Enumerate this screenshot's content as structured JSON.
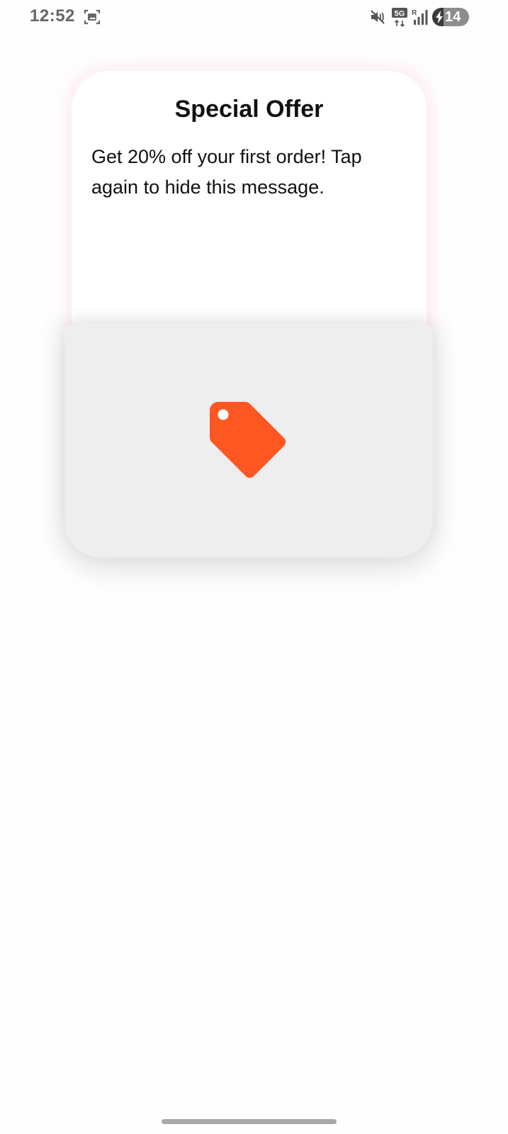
{
  "status_bar": {
    "time": "12:52",
    "network_label": "5G",
    "roaming_label": "R",
    "battery_level": "14",
    "icons": [
      "screenshot-icon",
      "mute-icon",
      "5g-network-icon",
      "signal-icon",
      "battery-charging-icon"
    ]
  },
  "offer": {
    "title": "Special Offer",
    "message": "Get 20% off your first order! Tap again to hide this message."
  },
  "cover": {
    "icon": "tag-icon",
    "icon_color": "#FF5722"
  },
  "colors": {
    "cover_background": "#EEEEEE",
    "card_background": "#FFFFFF",
    "accent": "#FF5722"
  }
}
